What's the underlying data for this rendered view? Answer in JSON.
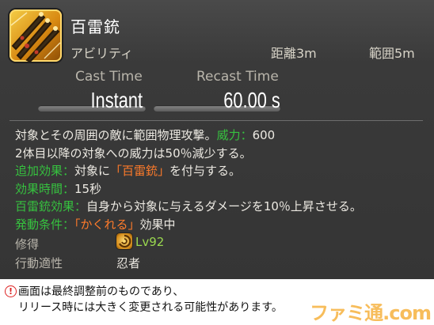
{
  "skill": {
    "name": "百雷銃",
    "type": "アビリティ",
    "range": "距離3m",
    "radius": "範囲5m"
  },
  "timing": {
    "cast_label": "Cast Time",
    "cast_value": "Instant",
    "recast_label": "Recast Time",
    "recast_value": "60.00 s"
  },
  "description": {
    "line1_text": "対象とその周囲の敵に範囲物理攻撃。",
    "line1_potency_label": "威力",
    "line1_potency_colon": "：",
    "line1_potency_value": "600",
    "line2": "2体目以降の対象への威力は50％減少する。",
    "line3_label": "追加効果：",
    "line3_pre": "対象に",
    "line3_status": "「百雷銃」",
    "line3_post": "を付与する。",
    "line4_label": "効果時間：",
    "line4_value": "15秒",
    "line5_label": "百雷銃効果：",
    "line5_value": "自身から対象に与えるダメージを10％上昇させる。",
    "line6_label": "発動条件：",
    "line6_status": "「かくれる」",
    "line6_post": "効果中"
  },
  "requirements": {
    "learn_label": "修得",
    "level": "Lv92",
    "class_label": "行動適性",
    "class_value": "忍者"
  },
  "note": {
    "line1": "画面は最終調整前のものであり、",
    "line2": "リリース時には大きく変更される可能性があります。"
  },
  "watermark": "ファミ通.com",
  "colors": {
    "effect_label": "#36c23f",
    "status_highlight": "#ff7b2a",
    "level": "#9ad84f",
    "note_icon": "#dd2222"
  },
  "icons": {
    "skill": "triple-kunai-skill-icon",
    "job": "ninja-job-icon",
    "note": "exclamation-circle-icon"
  }
}
